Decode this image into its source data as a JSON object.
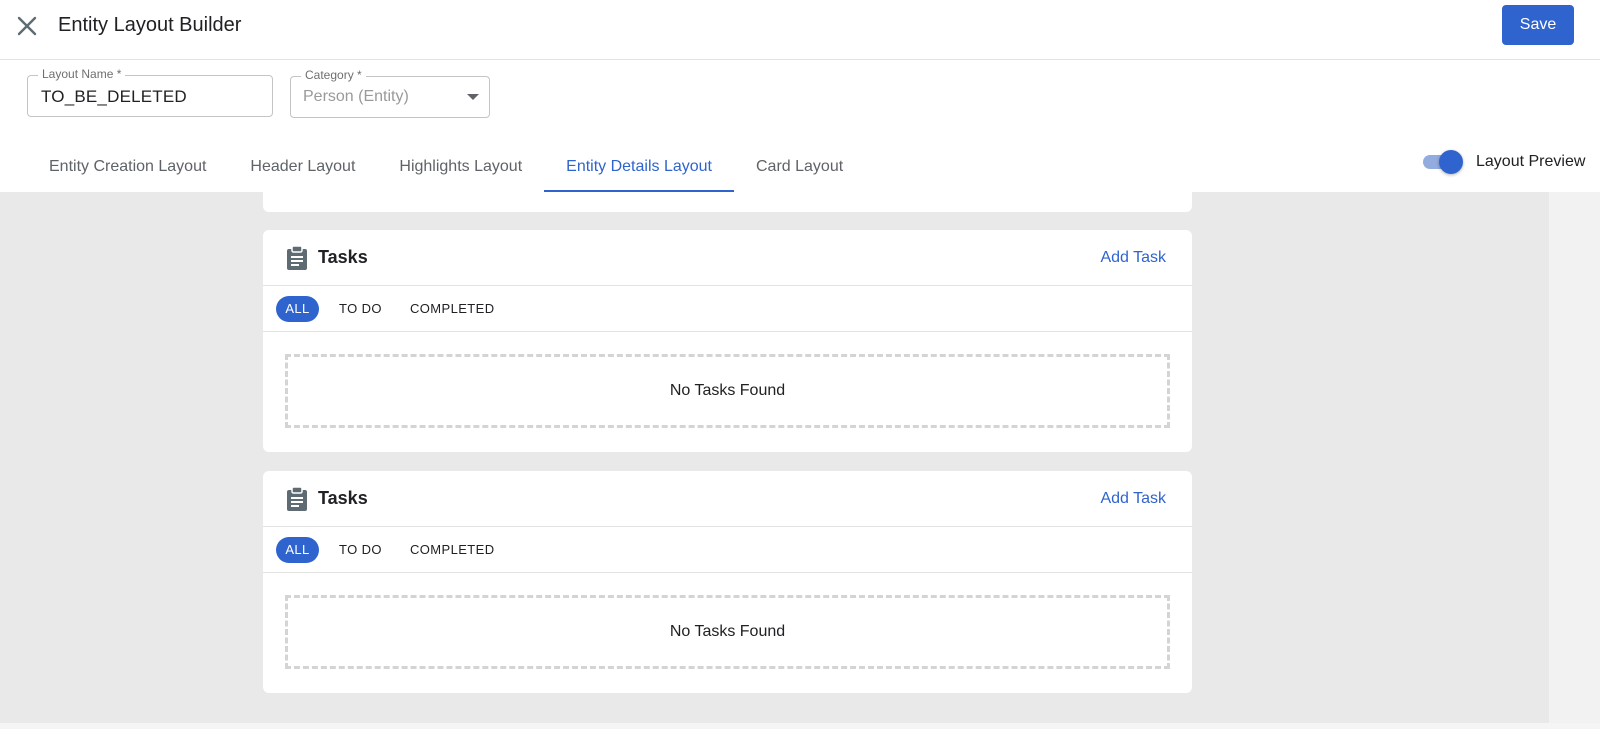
{
  "header": {
    "title": "Entity Layout Builder",
    "save_label": "Save"
  },
  "form": {
    "layout_name": {
      "label": "Layout Name *",
      "value": "TO_BE_DELETED"
    },
    "category": {
      "label": "Category *",
      "value": "Person (Entity)"
    }
  },
  "tabs": [
    {
      "label": "Entity Creation Layout",
      "active": false
    },
    {
      "label": "Header Layout",
      "active": false
    },
    {
      "label": "Highlights Layout",
      "active": false
    },
    {
      "label": "Entity Details Layout",
      "active": true
    },
    {
      "label": "Card Layout",
      "active": false
    }
  ],
  "preview": {
    "label": "Layout Preview",
    "enabled": true
  },
  "cards": [
    {
      "title": "Tasks",
      "icon": "clipboard-icon",
      "action_label": "Add Task",
      "filters": [
        "ALL",
        "TO DO",
        "COMPLETED"
      ],
      "active_filter": "ALL",
      "empty_text": "No Tasks Found"
    },
    {
      "title": "Tasks",
      "icon": "clipboard-icon",
      "action_label": "Add Task",
      "filters": [
        "ALL",
        "TO DO",
        "COMPLETED"
      ],
      "active_filter": "ALL",
      "empty_text": "No Tasks Found"
    }
  ],
  "colors": {
    "accent": "#2f64cf",
    "background": "#e9e9e9",
    "icon": "#5f6b73"
  }
}
